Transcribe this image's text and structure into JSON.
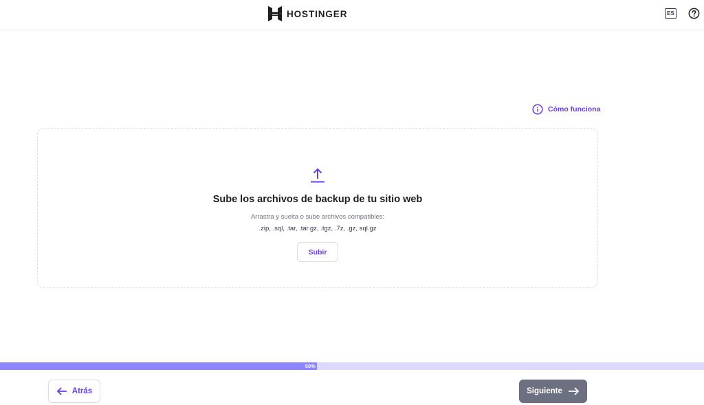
{
  "header": {
    "brand": "HOSTINGER",
    "language": "ES"
  },
  "help_link": {
    "label": "Cómo funciona"
  },
  "dropzone": {
    "title": "Sube los archivos de backup de tu sitio web",
    "subtitle": "Arrastra y suelta o sube archivos compatibles:",
    "formats": ".zip, .sql, .tar, .tar.gz, .tgz, .7z, .gz, sql.gz",
    "upload_label": "Subir"
  },
  "progress": {
    "label": "50%",
    "value": 0.45
  },
  "footer": {
    "back_label": "Atrás",
    "next_label": "Siguiente"
  },
  "icons": {
    "logo": "hostinger-logo-icon",
    "help": "help-circle-icon",
    "info": "info-icon",
    "upload": "upload-icon",
    "back": "arrow-left-icon",
    "next": "arrow-right-icon"
  },
  "colors": {
    "accent": "#673de6",
    "progress_fill": "#8c85ff",
    "progress_track": "#dcd9fc",
    "next_button": "#6d7081"
  }
}
